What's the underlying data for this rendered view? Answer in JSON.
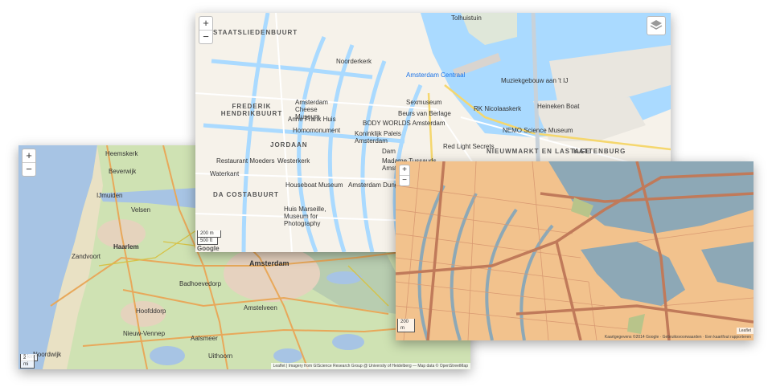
{
  "controls": {
    "zoom_in": "+",
    "zoom_out": "−"
  },
  "left_map": {
    "labels": {
      "amsterdam": "Amsterdam",
      "haarlem": "Haarlem",
      "zandvoort": "Zandvoort",
      "ijmuiden": "IJmuiden",
      "beverwijk": "Beverwijk",
      "hoofddorp": "Hoofddorp",
      "badhoevedorp": "Badhoevedorp",
      "amstelveen": "Amstelveen",
      "uithoorn": "Uithoorn",
      "aalsmeer": "Aalsmeer",
      "noordwijk": "Noordwijk",
      "nieuw_vennep": "Nieuw-Vennep",
      "heemskerk": "Heemskerk",
      "velsen": "Velsen"
    },
    "scale_km": "5 km",
    "scale_mi": "2 mi",
    "attribution": "Leaflet | Imagery from GIScience Research Group @ University of Heidelberg — Map data © OpenStreetMap"
  },
  "top_map": {
    "labels": {
      "staatslieden": "STAATSLIEDENBUURT",
      "frederik": "FREDERIK HENDRIKBUURT",
      "jordaan": "JORDAAN",
      "da_costa": "DA COSTABUURT",
      "nieuwmarkt": "NIEUWMARKT EN LASTAGE",
      "kattenburg": "KATTENBURG",
      "centraal": "Amsterdam Centraal",
      "anne_frank": "Anne Frank Huis",
      "cheese": "Amsterdam Cheese Museum",
      "noorderkerk": "Noorderkerk",
      "nemo": "NEMO Science Museum",
      "muziekgebouw": "Muziekgebouw aan 't IJ",
      "sexmuseum": "Sexmuseum",
      "dam": "Dam",
      "madame": "Madame Tussauds Amsterdam",
      "houseboat": "Houseboat Museum",
      "dungeon": "Amsterdam Dungeon",
      "huis_marseille": "Huis Marseille, Museum for Photography",
      "red_light": "Red Light Secrets",
      "heineken": "Heineken Boat",
      "tolhuistuin": "Tolhuistuin",
      "body_worlds": "BODY WORLDS Amsterdam",
      "homomonument": "Homomonument",
      "westerkerk": "Westerkerk",
      "waterkant": "Waterkant",
      "koninklijk": "Koninklijk Paleis Amsterdam",
      "rk": "RK Nicolaaskerk",
      "beurs": "Beurs van Berlage",
      "restaurant": "Restaurant Moeders"
    },
    "scale_m": "200 m",
    "scale_ft": "500 ft",
    "google": "Google"
  },
  "right_map": {
    "scale_m": "200 m",
    "attribution": "Leaflet",
    "credits": "Kaartgegevens ©2014 Google · Gebruiksvoorwaarden · Een kaartfout rapporteren"
  },
  "colors": {
    "water": "#aadaff",
    "land_satellite": "#cfe2b3",
    "roads_orange": "#f4b37d",
    "street_map": "#f6f2ea",
    "vector_land": "#f2c28d",
    "vector_road": "#c07a5a",
    "vector_water": "#8da8b6"
  }
}
